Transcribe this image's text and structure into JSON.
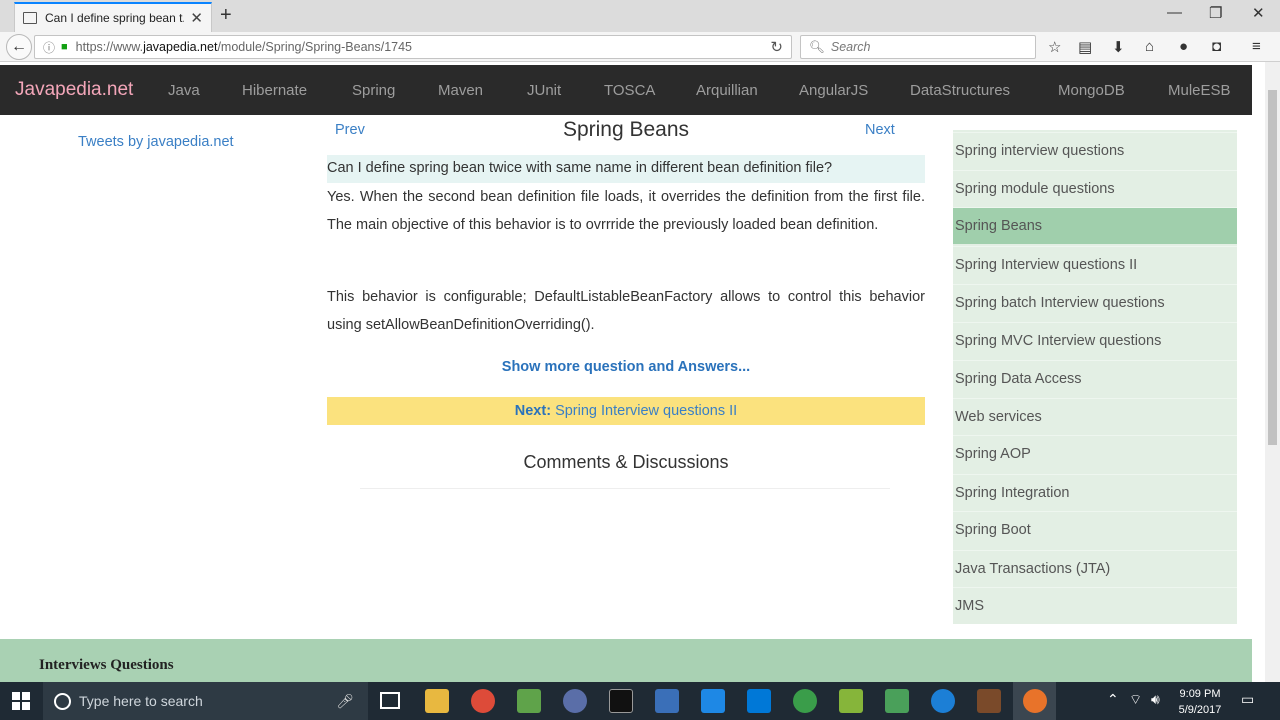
{
  "browser": {
    "tab_title": "Can I define spring bean t...",
    "url_prefix": "https://www.",
    "url_host": "javapedia.net",
    "url_path": "/module/Spring/Spring-Beans/1745",
    "search_placeholder": "Search"
  },
  "site": {
    "brand": "Javapedia.net",
    "nav": [
      "Java",
      "Hibernate",
      "Spring",
      "Maven",
      "JUnit",
      "TOSCA",
      "Arquillian",
      "AngularJS",
      "DataStructures",
      "MongoDB",
      "MuleESB"
    ]
  },
  "left": {
    "tweets_link": "Tweets by javapedia.net"
  },
  "article": {
    "prev": "Prev",
    "next": "Next",
    "title": "Spring Beans",
    "question": "Can I define spring bean twice with same name in different bean definition file?",
    "answer_p1": "Yes. When the second bean definition file loads, it overrides the definition from the first file. The main objective of this behavior is to ovrrride the previously loaded bean definition.",
    "answer_p2": "This behavior is configurable; DefaultListableBeanFactory allows to control this behavior using setAllowBeanDefinitionOverriding().",
    "show_more": "Show more question and Answers...",
    "next_label": "Next:",
    "next_link": "Spring Interview questions II",
    "comments": "Comments & Discussions"
  },
  "sidebar": {
    "active_index": 2,
    "items": [
      "Spring interview questions",
      "Spring module questions",
      "Spring Beans",
      "Spring Interview questions II",
      "Spring batch Interview questions",
      "Spring MVC Interview questions",
      "Spring Data Access",
      "Web services",
      "Spring AOP",
      "Spring Integration",
      "Spring Boot",
      "Java Transactions (JTA)",
      "JMS"
    ]
  },
  "footer": {
    "title": "Interviews Questions"
  },
  "taskbar": {
    "search_placeholder": "Type here to search",
    "time": "9:09 PM",
    "date": "5/9/2017"
  },
  "colors": {
    "brand": "#f3a6b9",
    "link": "#3a7fc5",
    "sidebar_bg": "#e3efe4",
    "sidebar_active": "#a0cfac",
    "next_bar": "#fbe27e",
    "footer": "#a9d1b3"
  }
}
